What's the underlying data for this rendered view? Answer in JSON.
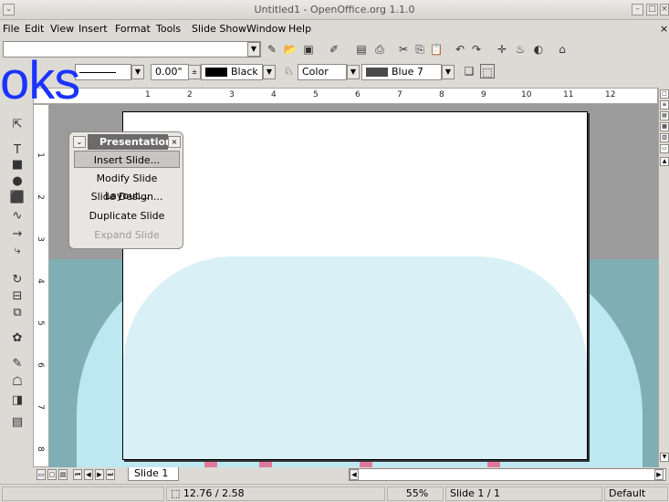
{
  "window": {
    "title": "Untitled1 - OpenOffice.org 1.1.0"
  },
  "menu": [
    "File",
    "Edit",
    "View",
    "Insert",
    "Format",
    "Tools",
    "Slide Show",
    "Window",
    "Help"
  ],
  "watermark": "oks",
  "line_toolbar": {
    "line_width": "0.00\"",
    "line_color": "Black",
    "area_style": "Color",
    "area_color": "Blue 7"
  },
  "ruler": {
    "h": [
      "1",
      "2",
      "3",
      "4",
      "5",
      "6",
      "7",
      "8",
      "9",
      "10",
      "11",
      "12"
    ],
    "v": [
      "1",
      "2",
      "3",
      "4",
      "5",
      "6",
      "7",
      "8"
    ]
  },
  "presentation_popup": {
    "title": "Presentation",
    "items": [
      "Insert Slide...",
      "Modify Slide Layout...",
      "Slide Design...",
      "Duplicate Slide",
      "Expand Slide"
    ]
  },
  "tabs": {
    "slide_tab": "Slide 1"
  },
  "status": {
    "position": "12.76 / 2.58",
    "zoom": "55%",
    "slide": "Slide 1 / 1",
    "layout": "Default"
  },
  "colors": {
    "line_color": "#000000",
    "area_color": "#4a4a4a",
    "popup_title_bg": "#6b6b6b",
    "watermark": "#1a33ff"
  }
}
